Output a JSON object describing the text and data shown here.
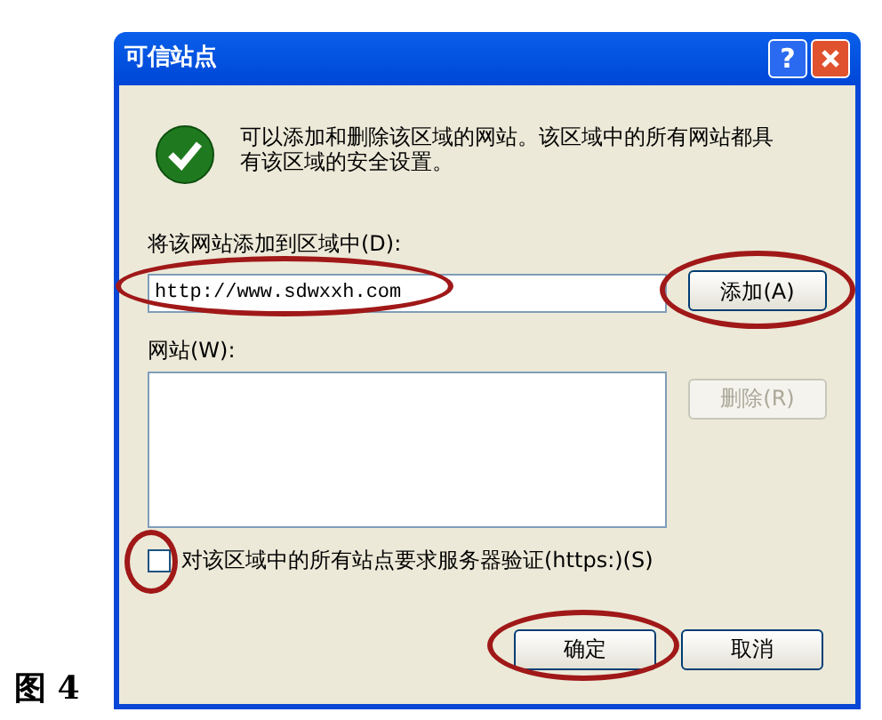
{
  "dialog": {
    "title": "可信站点",
    "help_button": "?",
    "info_text": "可以添加和删除该区域的网站。该区域中的所有网站都具有该区域的安全设置。",
    "add_label": "将该网站添加到区域中(D):",
    "url_field": {
      "value": "http://www.sdwxxh.com",
      "circled": true
    },
    "add_button": {
      "label": "添加(A)",
      "circled": true,
      "disabled": false
    },
    "websites_label": "网站(W):",
    "remove_button": {
      "label": "删除(R)",
      "disabled": true
    },
    "https_checkbox": {
      "label": "对该区域中的所有站点要求服务器验证(https:)(S)",
      "checked": false,
      "circled": true
    },
    "buttons": [
      {
        "label": "确定",
        "circled": true
      },
      {
        "label": "取消",
        "circled": false
      }
    ]
  },
  "caption": "图 4"
}
